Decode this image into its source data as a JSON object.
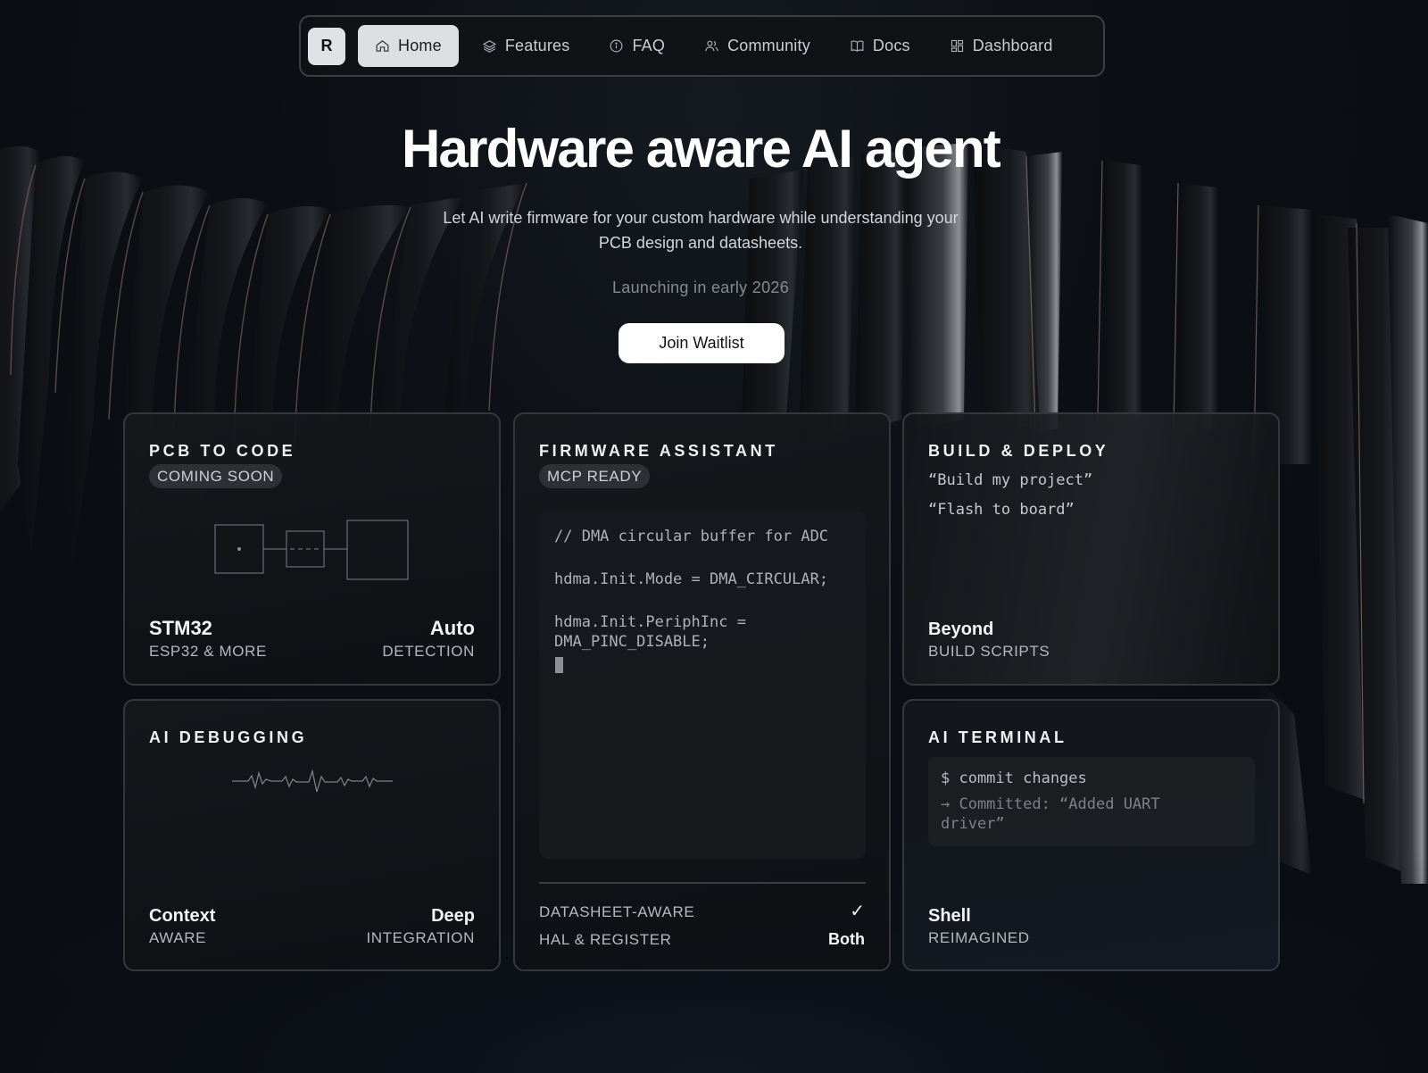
{
  "nav": {
    "logo": "R",
    "items": [
      {
        "label": "Home",
        "icon": "home-icon",
        "active": true
      },
      {
        "label": "Features",
        "icon": "layers-icon",
        "active": false
      },
      {
        "label": "FAQ",
        "icon": "info-icon",
        "active": false
      },
      {
        "label": "Community",
        "icon": "users-icon",
        "active": false
      },
      {
        "label": "Docs",
        "icon": "book-icon",
        "active": false
      },
      {
        "label": "Dashboard",
        "icon": "grid-icon",
        "active": false
      }
    ]
  },
  "hero": {
    "title": "Hardware aware AI agent",
    "subtitle": "Let AI write firmware for your custom hardware while understanding your PCB design and datasheets.",
    "launch": "Launching in early 2026",
    "cta": "Join Waitlist"
  },
  "cards": {
    "pcb": {
      "title": "PCB TO CODE",
      "badge": "COMING SOON",
      "left_big": "STM32",
      "left_small": "ESP32 & MORE",
      "right_big": "Auto",
      "right_small": "DETECTION"
    },
    "firmware": {
      "title": "FIRMWARE ASSISTANT",
      "badge": "MCP READY",
      "code": [
        "// DMA circular buffer for ADC",
        "hdma.Init.Mode = DMA_CIRCULAR;",
        "hdma.Init.PeriphInc = DMA_PINC_DISABLE;"
      ],
      "row1_label": "DATASHEET-AWARE",
      "row1_value": "✓",
      "row2_label": "HAL & REGISTER",
      "row2_value": "Both"
    },
    "build": {
      "title": "BUILD & DEPLOY",
      "quote1": "“Build my project”",
      "quote2": "“Flash to board”",
      "big": "Beyond",
      "small": "BUILD SCRIPTS"
    },
    "debug": {
      "title": "AI DEBUGGING",
      "left_big": "Context",
      "left_small": "AWARE",
      "right_big": "Deep",
      "right_small": "INTEGRATION"
    },
    "terminal": {
      "title": "AI TERMINAL",
      "command": "$ commit changes",
      "output": "→ Committed: “Added UART driver”",
      "big": "Shell",
      "small": "REIMAGINED"
    }
  },
  "colors": {
    "background": "#0b0e13",
    "card_border": "#34383e",
    "accent": "#ffffff"
  }
}
